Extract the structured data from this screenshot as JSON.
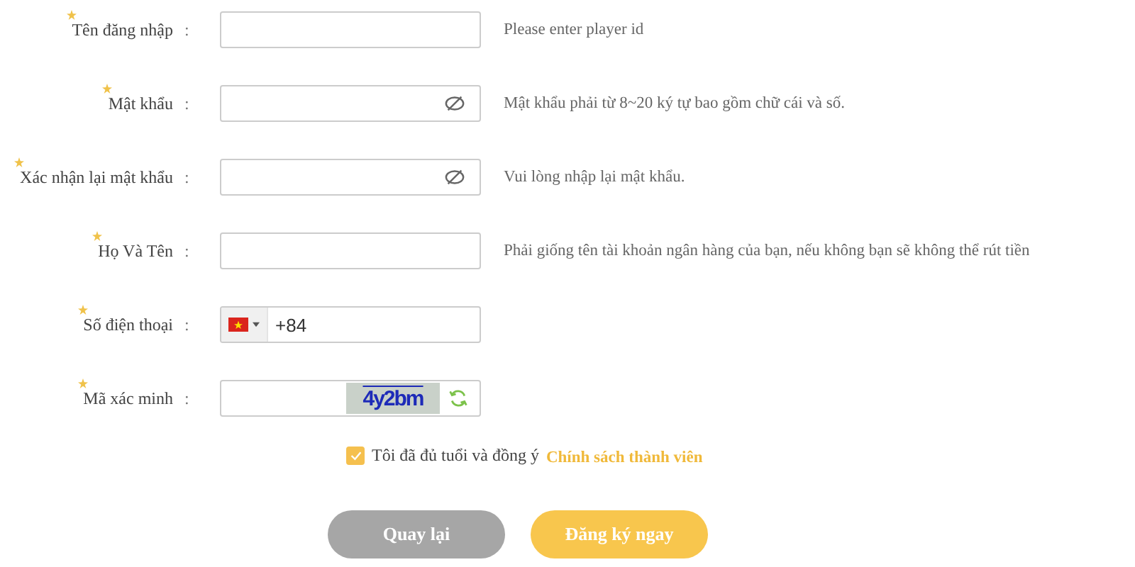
{
  "fields": [
    {
      "kind": "text",
      "label": "Tên đăng nhập",
      "colon": ":",
      "required": true,
      "hint": "Please enter player id"
    },
    {
      "kind": "password",
      "label": "Mật khẩu",
      "colon": ":",
      "required": true,
      "hint": "Mật khẩu phải từ 8~20 ký tự bao gồm chữ cái và số."
    },
    {
      "kind": "password",
      "label": "Xác nhận lại mật khẩu",
      "colon": ":",
      "required": true,
      "hint": "Vui lòng nhập lại mật khẩu."
    },
    {
      "kind": "text",
      "label": "Họ Và Tên",
      "colon": ":",
      "required": true,
      "hint": "Phải giống tên tài khoản ngân hàng của bạn, nếu không bạn sẽ không thể rút tiền"
    },
    {
      "kind": "phone",
      "label": "Số điện thoại",
      "colon": ":",
      "required": true,
      "value": "+84"
    },
    {
      "kind": "captcha",
      "label": "Mã xác minh",
      "colon": ":",
      "required": true,
      "captcha": "4y2bm"
    }
  ],
  "agreement": {
    "checked": true,
    "text": "Tôi đã đủ tuổi và đồng ý",
    "link": "Chính sách thành viên"
  },
  "buttons": [
    {
      "label": "Quay lại",
      "kind": "back"
    },
    {
      "label": "Đăng ký ngay",
      "kind": "primary"
    }
  ]
}
